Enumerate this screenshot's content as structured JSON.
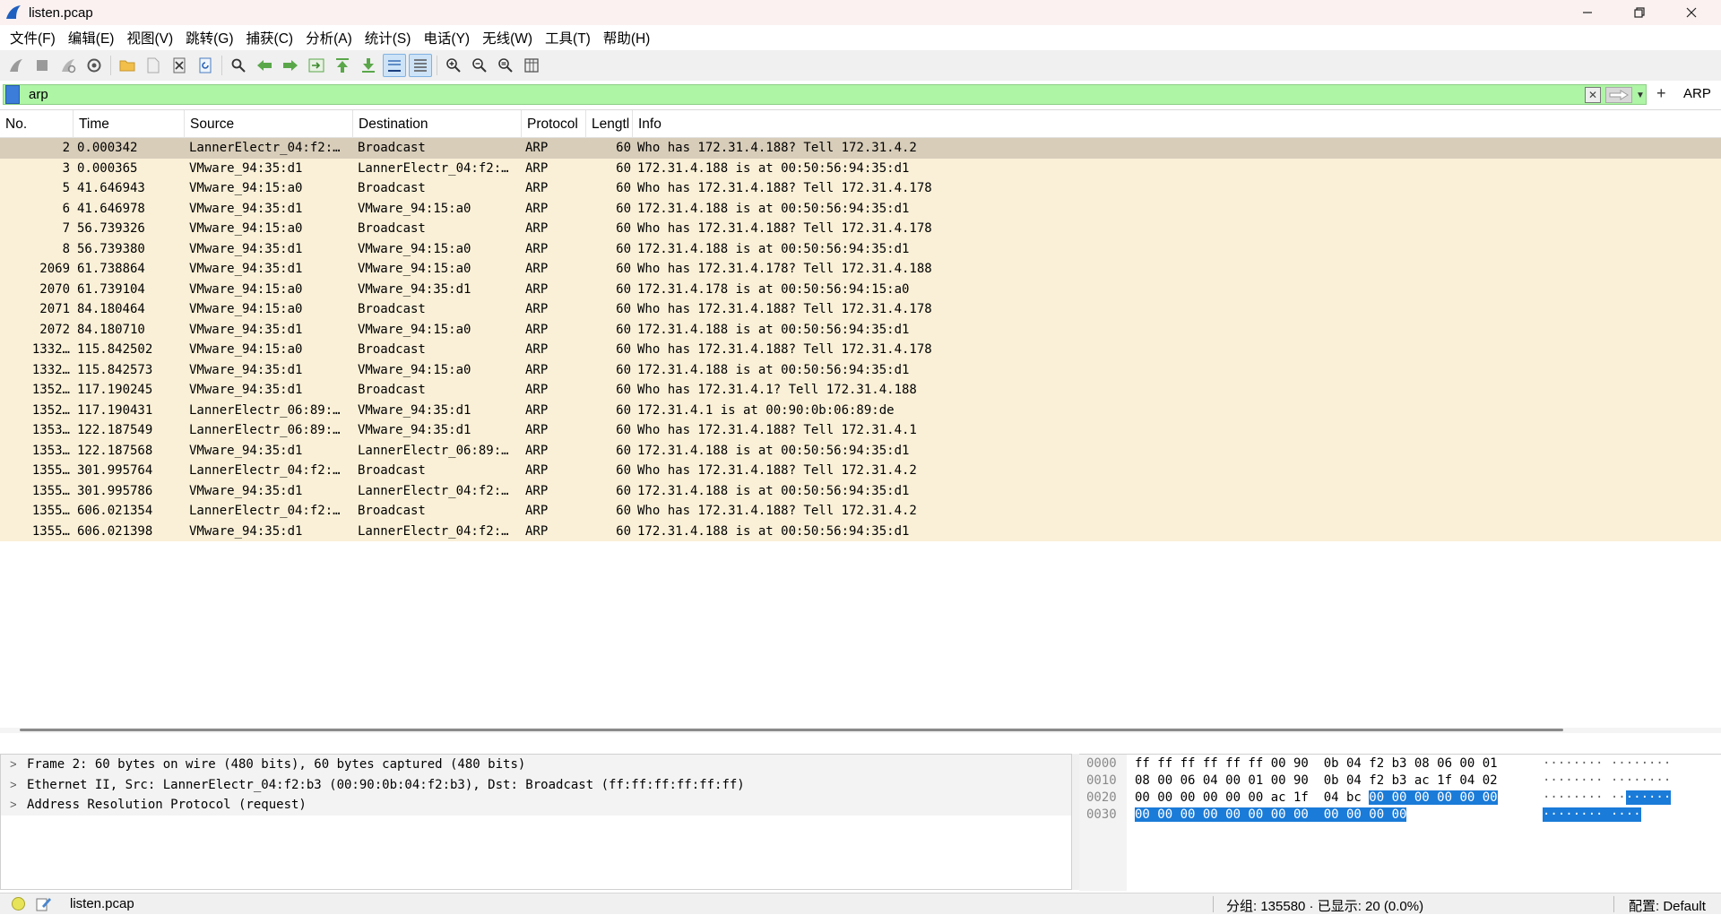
{
  "window": {
    "title": "listen.pcap",
    "controls": [
      "minimize-icon",
      "restore-icon",
      "close-icon"
    ]
  },
  "menu": [
    "文件(F)",
    "编辑(E)",
    "视图(V)",
    "跳转(G)",
    "捕获(C)",
    "分析(A)",
    "统计(S)",
    "电话(Y)",
    "无线(W)",
    "工具(T)",
    "帮助(H)"
  ],
  "toolbar": {
    "icons": [
      "start-capture-icon",
      "stop-capture-icon",
      "restart-capture-icon",
      "capture-options-icon",
      "open-file-icon",
      "save-file-icon",
      "close-file-icon",
      "reload-file-icon",
      "find-packet-icon",
      "go-back-icon",
      "go-forward-icon",
      "go-to-packet-icon",
      "go-first-icon",
      "go-last-icon",
      "auto-scroll-icon",
      "colorize-icon",
      "zoom-in-icon",
      "zoom-out-icon",
      "zoom-normal-icon",
      "resize-columns-icon"
    ]
  },
  "filter": {
    "value": "arp",
    "label": "ARP",
    "add": "+"
  },
  "packet_list": {
    "columns": [
      "No.",
      "Time",
      "Source",
      "Destination",
      "Protocol",
      "Lengtl",
      "Info"
    ],
    "rows": [
      {
        "no": "2",
        "time": "0.000342",
        "src": "LannerElectr_04:f2:…",
        "dst": "Broadcast",
        "proto": "ARP",
        "len": "60",
        "info": "Who has 172.31.4.188? Tell 172.31.4.2"
      },
      {
        "no": "3",
        "time": "0.000365",
        "src": "VMware_94:35:d1",
        "dst": "LannerElectr_04:f2:…",
        "proto": "ARP",
        "len": "60",
        "info": "172.31.4.188 is at 00:50:56:94:35:d1"
      },
      {
        "no": "5",
        "time": "41.646943",
        "src": "VMware_94:15:a0",
        "dst": "Broadcast",
        "proto": "ARP",
        "len": "60",
        "info": "Who has 172.31.4.188? Tell 172.31.4.178"
      },
      {
        "no": "6",
        "time": "41.646978",
        "src": "VMware_94:35:d1",
        "dst": "VMware_94:15:a0",
        "proto": "ARP",
        "len": "60",
        "info": "172.31.4.188 is at 00:50:56:94:35:d1"
      },
      {
        "no": "7",
        "time": "56.739326",
        "src": "VMware_94:15:a0",
        "dst": "Broadcast",
        "proto": "ARP",
        "len": "60",
        "info": "Who has 172.31.4.188? Tell 172.31.4.178"
      },
      {
        "no": "8",
        "time": "56.739380",
        "src": "VMware_94:35:d1",
        "dst": "VMware_94:15:a0",
        "proto": "ARP",
        "len": "60",
        "info": "172.31.4.188 is at 00:50:56:94:35:d1"
      },
      {
        "no": "2069",
        "time": "61.738864",
        "src": "VMware_94:35:d1",
        "dst": "VMware_94:15:a0",
        "proto": "ARP",
        "len": "60",
        "info": "Who has 172.31.4.178? Tell 172.31.4.188"
      },
      {
        "no": "2070",
        "time": "61.739104",
        "src": "VMware_94:15:a0",
        "dst": "VMware_94:35:d1",
        "proto": "ARP",
        "len": "60",
        "info": "172.31.4.178 is at 00:50:56:94:15:a0"
      },
      {
        "no": "2071",
        "time": "84.180464",
        "src": "VMware_94:15:a0",
        "dst": "Broadcast",
        "proto": "ARP",
        "len": "60",
        "info": "Who has 172.31.4.188? Tell 172.31.4.178"
      },
      {
        "no": "2072",
        "time": "84.180710",
        "src": "VMware_94:35:d1",
        "dst": "VMware_94:15:a0",
        "proto": "ARP",
        "len": "60",
        "info": "172.31.4.188 is at 00:50:56:94:35:d1"
      },
      {
        "no": "1332…",
        "time": "115.842502",
        "src": "VMware_94:15:a0",
        "dst": "Broadcast",
        "proto": "ARP",
        "len": "60",
        "info": "Who has 172.31.4.188? Tell 172.31.4.178"
      },
      {
        "no": "1332…",
        "time": "115.842573",
        "src": "VMware_94:35:d1",
        "dst": "VMware_94:15:a0",
        "proto": "ARP",
        "len": "60",
        "info": "172.31.4.188 is at 00:50:56:94:35:d1"
      },
      {
        "no": "1352…",
        "time": "117.190245",
        "src": "VMware_94:35:d1",
        "dst": "Broadcast",
        "proto": "ARP",
        "len": "60",
        "info": "Who has 172.31.4.1? Tell 172.31.4.188"
      },
      {
        "no": "1352…",
        "time": "117.190431",
        "src": "LannerElectr_06:89:…",
        "dst": "VMware_94:35:d1",
        "proto": "ARP",
        "len": "60",
        "info": "172.31.4.1 is at 00:90:0b:06:89:de"
      },
      {
        "no": "1353…",
        "time": "122.187549",
        "src": "LannerElectr_06:89:…",
        "dst": "VMware_94:35:d1",
        "proto": "ARP",
        "len": "60",
        "info": "Who has 172.31.4.188? Tell 172.31.4.1"
      },
      {
        "no": "1353…",
        "time": "122.187568",
        "src": "VMware_94:35:d1",
        "dst": "LannerElectr_06:89:…",
        "proto": "ARP",
        "len": "60",
        "info": "172.31.4.188 is at 00:50:56:94:35:d1"
      },
      {
        "no": "1355…",
        "time": "301.995764",
        "src": "LannerElectr_04:f2:…",
        "dst": "Broadcast",
        "proto": "ARP",
        "len": "60",
        "info": "Who has 172.31.4.188? Tell 172.31.4.2"
      },
      {
        "no": "1355…",
        "time": "301.995786",
        "src": "VMware_94:35:d1",
        "dst": "LannerElectr_04:f2:…",
        "proto": "ARP",
        "len": "60",
        "info": "172.31.4.188 is at 00:50:56:94:35:d1"
      },
      {
        "no": "1355…",
        "time": "606.021354",
        "src": "LannerElectr_04:f2:…",
        "dst": "Broadcast",
        "proto": "ARP",
        "len": "60",
        "info": "Who has 172.31.4.188? Tell 172.31.4.2"
      },
      {
        "no": "1355…",
        "time": "606.021398",
        "src": "VMware_94:35:d1",
        "dst": "LannerElectr_04:f2:…",
        "proto": "ARP",
        "len": "60",
        "info": "172.31.4.188 is at 00:50:56:94:35:d1"
      }
    ],
    "selected_index": 0
  },
  "details": [
    {
      "expander": ">",
      "text": "Frame 2: 60 bytes on wire (480 bits), 60 bytes captured (480 bits)"
    },
    {
      "expander": ">",
      "text": "Ethernet II, Src: LannerElectr_04:f2:b3 (00:90:0b:04:f2:b3), Dst: Broadcast (ff:ff:ff:ff:ff:ff)"
    },
    {
      "expander": ">",
      "text": "Address Resolution Protocol (request)"
    }
  ],
  "bytes": {
    "lines": [
      {
        "offset": "0000",
        "hex_plain": "ff ff ff ff ff ff 00 90  0b 04 f2 b3 08 06 00 01",
        "hex_hl": "",
        "ascii_plain": "········ ········",
        "ascii_hl": ""
      },
      {
        "offset": "0010",
        "hex_plain": "08 00 06 04 00 01 00 90  0b 04 f2 b3 ac 1f 04 02",
        "hex_hl": "",
        "ascii_plain": "········ ········",
        "ascii_hl": ""
      },
      {
        "offset": "0020",
        "hex_plain": "00 00 00 00 00 00 ac 1f  04 bc ",
        "hex_hl": "00 00 00 00 00 00",
        "ascii_plain": "········ ··",
        "ascii_hl": "······"
      },
      {
        "offset": "0030",
        "hex_plain": "",
        "hex_hl": "00 00 00 00 00 00 00 00  00 00 00 00",
        "ascii_plain": "",
        "ascii_hl": "········ ····"
      }
    ]
  },
  "status": {
    "file": "listen.pcap",
    "packets": "分组: 135580 · 已显示: 20 (0.0%)",
    "profile": "配置: Default"
  }
}
